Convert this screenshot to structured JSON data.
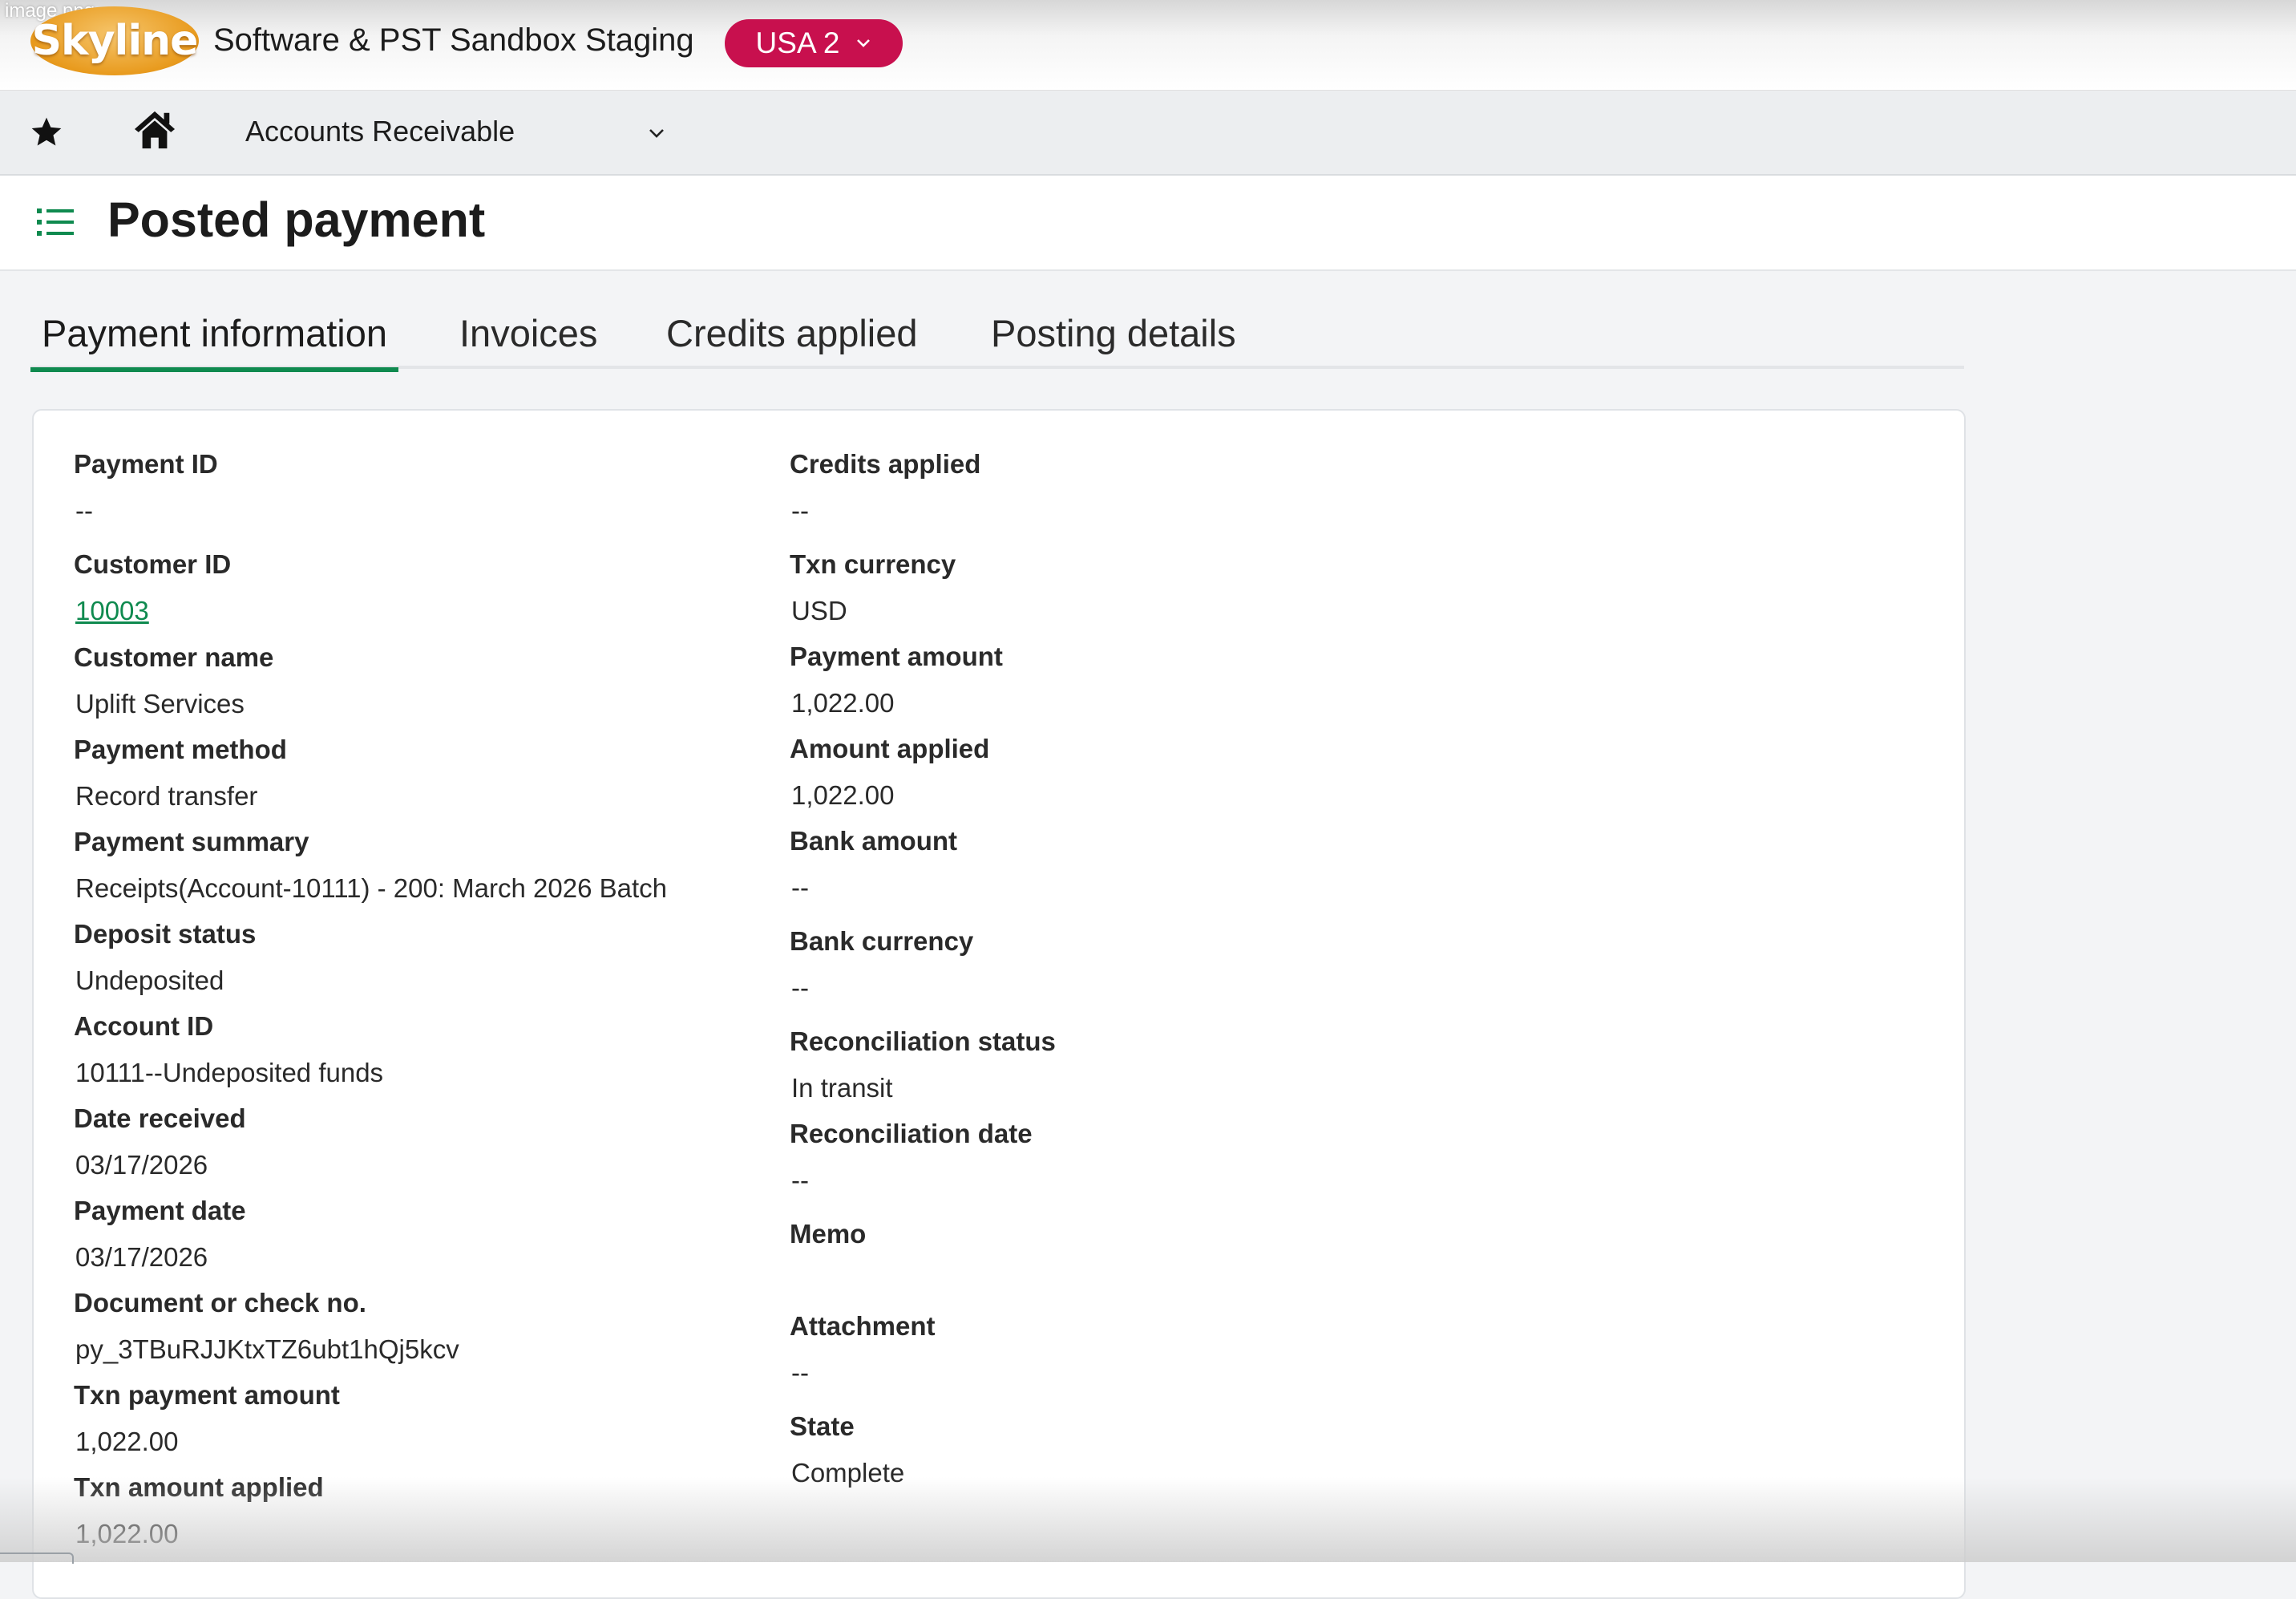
{
  "file_label": "image.png",
  "header": {
    "logo_text": "Skyline",
    "company": "Software & PST Sandbox Staging",
    "entity": "USA 2"
  },
  "nav": {
    "module": "Accounts Receivable"
  },
  "page": {
    "title": "Posted payment"
  },
  "tabs": [
    {
      "label": "Payment information",
      "active": true
    },
    {
      "label": "Invoices",
      "active": false
    },
    {
      "label": "Credits applied",
      "active": false
    },
    {
      "label": "Posting details",
      "active": false
    }
  ],
  "left_fields": [
    {
      "label": "Payment ID",
      "value": "--"
    },
    {
      "label": "Customer ID",
      "value": "10003",
      "link": true
    },
    {
      "label": "Customer name",
      "value": "Uplift Services"
    },
    {
      "label": "Payment method",
      "value": "Record transfer"
    },
    {
      "label": "Payment summary",
      "value": "Receipts(Account-10111) - 200: March 2026 Batch"
    },
    {
      "label": "Deposit status",
      "value": "Undeposited"
    },
    {
      "label": "Account ID",
      "value": "10111--Undeposited funds"
    },
    {
      "label": "Date received",
      "value": "03/17/2026"
    },
    {
      "label": "Payment date",
      "value": "03/17/2026"
    },
    {
      "label": "Document or check no.",
      "value": "py_3TBuRJJKtxTZ6ubt1hQj5kcv"
    },
    {
      "label": "Txn payment amount",
      "value": "1,022.00"
    },
    {
      "label": "Txn amount applied",
      "value": "1,022.00"
    }
  ],
  "right_fields": [
    {
      "label": "Credits applied",
      "value": "--"
    },
    {
      "label": "Txn currency",
      "value": "USD"
    },
    {
      "label": "Payment amount",
      "value": "1,022.00"
    },
    {
      "label": "Amount applied",
      "value": "1,022.00"
    },
    {
      "label": "Bank amount",
      "value": "--"
    },
    {
      "label": "Bank currency",
      "value": "--"
    },
    {
      "label": "Reconciliation status",
      "value": "In transit"
    },
    {
      "label": "Reconciliation date",
      "value": "--"
    },
    {
      "label": "Memo",
      "value": ""
    },
    {
      "label": "Attachment",
      "value": "--"
    },
    {
      "label": "State",
      "value": "Complete"
    }
  ],
  "colors": {
    "accent_green": "#0f8a4f",
    "entity_magenta": "#c8104e",
    "logo_orange": "#e89a1d"
  },
  "icons": [
    "star-icon",
    "home-icon",
    "chevron-down-icon",
    "list-icon"
  ]
}
